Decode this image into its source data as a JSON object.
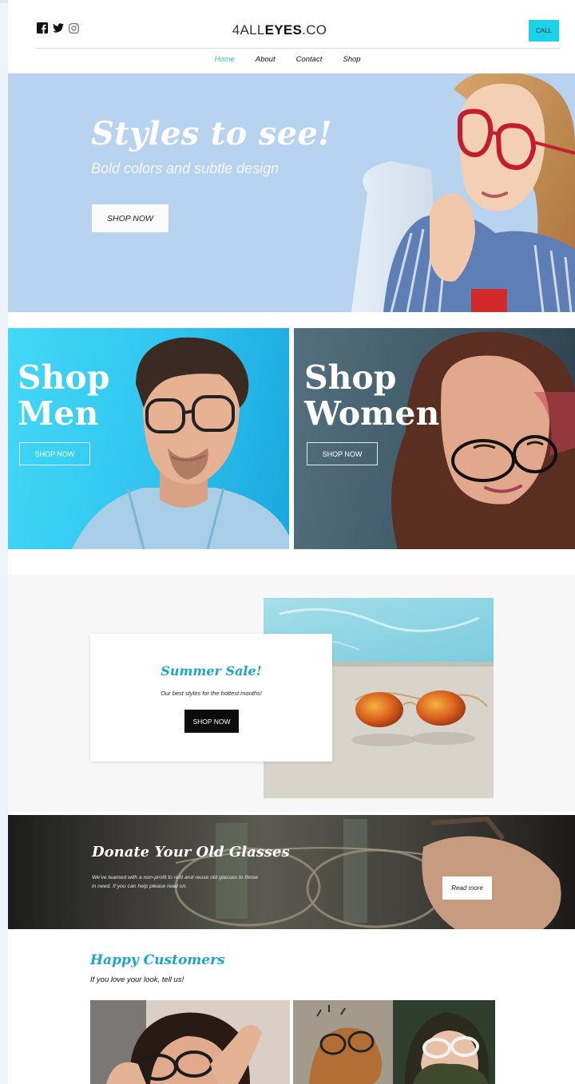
{
  "header": {
    "logo_part1": "4",
    "logo_part2": "ALL",
    "logo_part3": "EYES",
    "logo_part4": ".CO",
    "call_label": "CALL",
    "social_icons": [
      "facebook-icon",
      "twitter-icon",
      "instagram-icon"
    ]
  },
  "nav": {
    "items": [
      {
        "label": "Home",
        "active": true
      },
      {
        "label": "About",
        "active": false
      },
      {
        "label": "Contact",
        "active": false
      },
      {
        "label": "Shop",
        "active": false
      }
    ]
  },
  "hero": {
    "title": "Styles to see!",
    "subtitle": "Bold colors and subtle design",
    "button": "SHOP NOW"
  },
  "tiles": {
    "men": {
      "title_line1": "Shop",
      "title_line2": "Men",
      "button": "SHOP NOW"
    },
    "women": {
      "title_line1": "Shop",
      "title_line2": "Women",
      "button": "SHOP NOW"
    }
  },
  "sale": {
    "title": "Summer Sale!",
    "subtitle": "Our best styles for the hottest months!",
    "button": "SHOP NOW"
  },
  "donate": {
    "title": "Donate Your Old Glasses",
    "text": "We've teamed with a non-profit to refit and reuse old glasses to those in need. If you can help please read on.",
    "button": "Read more"
  },
  "customers": {
    "title": "Happy Customers",
    "subtitle": "If you love your look, tell us!"
  },
  "colors": {
    "accent": "#1bd3e8",
    "link_active": "#33bde3",
    "heading_teal": "#1aa6c8",
    "hero_bg": "#b7d3ef"
  }
}
